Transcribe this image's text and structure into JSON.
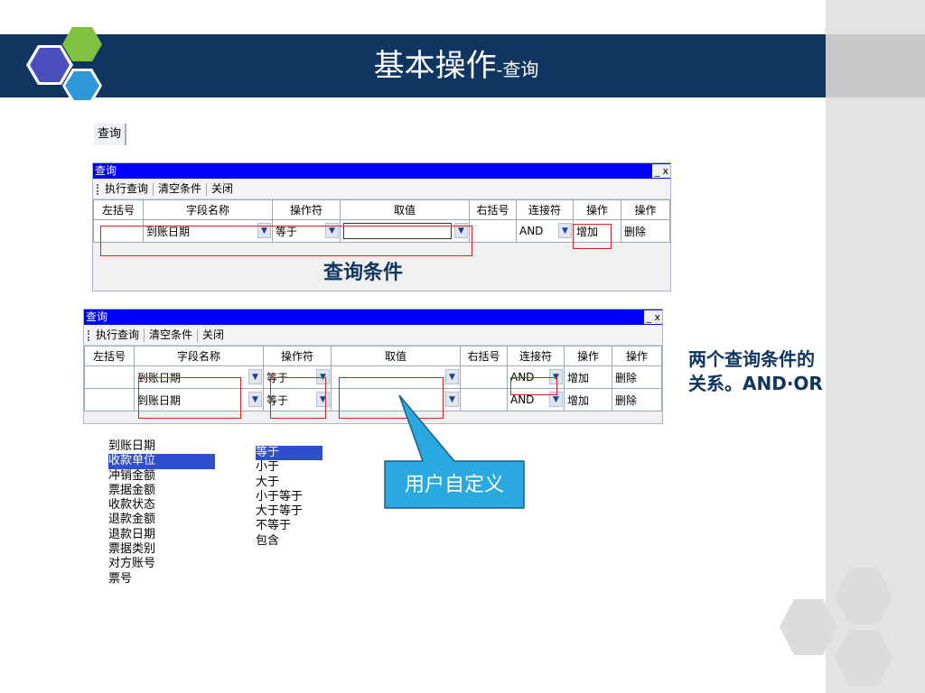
{
  "slide": {
    "title_main": "基本操作",
    "title_sub": "-查询"
  },
  "query_button": "查询",
  "panel_title": "查询",
  "window_buttons": "_ x",
  "toolbar": {
    "execute": "执行查询",
    "clear": "清空条件",
    "close": "关闭"
  },
  "columns": [
    "左括号",
    "字段名称",
    "操作符",
    "取值",
    "右括号",
    "连接符",
    "操作",
    "操作"
  ],
  "panel1_row": {
    "field": "到账日期",
    "operator": "等于",
    "value": "",
    "connector": "AND",
    "op_add": "增加",
    "op_delete": "删除"
  },
  "panel2_rows": [
    {
      "field": "到账日期",
      "operator": "等于",
      "value": "",
      "connector": "AND",
      "op_add": "增加",
      "op_delete": "删除"
    },
    {
      "field": "到账日期",
      "operator": "等于",
      "value": "",
      "connector": "AND",
      "op_add": "增加",
      "op_delete": "删除"
    }
  ],
  "condition_label": "查询条件",
  "side_note": {
    "line1": "两个查询条件的",
    "line2": "关系。AND·OR"
  },
  "field_options": [
    "到账日期",
    "收款单位",
    "冲销金额",
    "票据金额",
    "收款状态",
    "退款金额",
    "退款日期",
    "票据类别",
    "对方账号",
    "票号"
  ],
  "field_selected_index": 1,
  "operator_options": [
    "等于",
    "小于",
    "大于",
    "小于等于",
    "大于等于",
    "不等于",
    "包含"
  ],
  "operator_selected_index": 0,
  "callout_text": "用户自定义",
  "colors": {
    "title_band": "#0f3560",
    "titlebar": "#0000ff",
    "callout": "#29a9e0",
    "highlight": "#e02020",
    "accent_text": "#0f3560"
  }
}
